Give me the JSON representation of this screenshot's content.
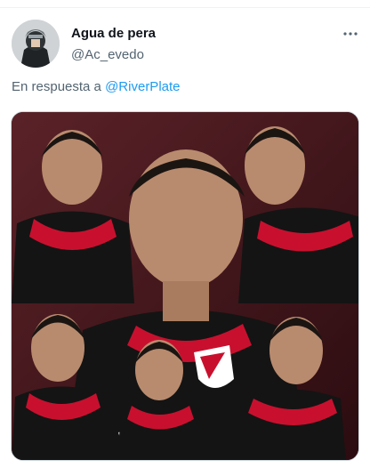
{
  "tweet": {
    "display_name": "Agua de pera",
    "handle": "@Ac_evedo",
    "reply_prefix": "En respuesta a",
    "reply_to": "@RiverPlate",
    "more_icon": "more-horizontal-icon",
    "media_description": "collage of a young man in a River Plate jersey",
    "colors": {
      "link": "#1d9bf0",
      "secondary_text": "#536471",
      "jersey_black": "#141414",
      "jersey_red": "#c8102e"
    }
  }
}
